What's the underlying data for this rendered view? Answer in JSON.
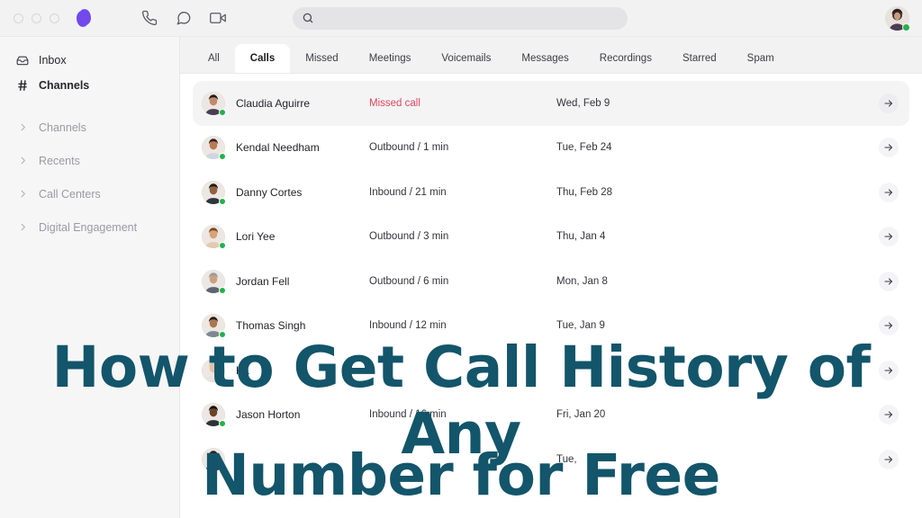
{
  "window": {
    "dots": [
      "close-dot",
      "minimize-dot",
      "maximize-dot"
    ],
    "logo_name": "app-logo",
    "logo_color": "#7149ec"
  },
  "topbar": {
    "icons": [
      {
        "name": "phone-icon",
        "label": "Phone"
      },
      {
        "name": "chat-icon",
        "label": "Messages"
      },
      {
        "name": "video-icon",
        "label": "Video"
      }
    ],
    "search": {
      "value": "",
      "placeholder": "",
      "icon": "search-icon"
    },
    "avatar": {
      "name": "user-avatar",
      "status": "online",
      "status_color": "#22b14c"
    }
  },
  "sidebar": {
    "primary": [
      {
        "label": "Inbox",
        "icon": "inbox-icon",
        "bold": false
      },
      {
        "label": "Channels",
        "icon": "hash-icon",
        "bold": true
      }
    ],
    "groups": [
      {
        "label": "Channels",
        "icon": "chevron-right-icon"
      },
      {
        "label": "Recents",
        "icon": "chevron-right-icon"
      },
      {
        "label": "Call Centers",
        "icon": "chevron-right-icon"
      },
      {
        "label": "Digital Engagement",
        "icon": "chevron-right-icon"
      }
    ]
  },
  "tabs": [
    {
      "label": "All",
      "active": false
    },
    {
      "label": "Calls",
      "active": true
    },
    {
      "label": "Missed",
      "active": false
    },
    {
      "label": "Meetings",
      "active": false
    },
    {
      "label": "Voicemails",
      "active": false
    },
    {
      "label": "Messages",
      "active": false
    },
    {
      "label": "Recordings",
      "active": false
    },
    {
      "label": "Starred",
      "active": false
    },
    {
      "label": "Spam",
      "active": false
    }
  ],
  "calls": [
    {
      "name": "Claudia Aguirre",
      "type": "Missed call",
      "missed": true,
      "date": "Wed, Feb 9",
      "selected": true,
      "avatar_color": "#3a3340",
      "status": "online"
    },
    {
      "name": "Kendal Needham",
      "type": "Outbound / 1 min",
      "missed": false,
      "date": "Tue, Feb 24",
      "selected": false,
      "avatar_color": "#7a4a2e",
      "status": "online"
    },
    {
      "name": "Danny Cortes",
      "type": "Inbound / 21 min",
      "missed": false,
      "date": "Thu, Feb 28",
      "selected": false,
      "avatar_color": "#4a3c33",
      "status": "online"
    },
    {
      "name": "Lori Yee",
      "type": "Outbound / 3 min",
      "missed": false,
      "date": "Thu, Jan 4",
      "selected": false,
      "avatar_color": "#b08968",
      "status": "online"
    },
    {
      "name": "Jordan Fell",
      "type": "Outbound / 6 min",
      "missed": false,
      "date": "Mon, Jan 8",
      "selected": false,
      "avatar_color": "#9a9a9e",
      "status": "online"
    },
    {
      "name": "Thomas Singh",
      "type": "Inbound / 12 min",
      "missed": false,
      "date": "Tue, Jan 9",
      "selected": false,
      "avatar_color": "#6b5344",
      "status": "online"
    },
    {
      "name": "Ka",
      "type": "",
      "missed": false,
      "date": "",
      "selected": false,
      "avatar_color": "#d2c0b0",
      "status": "online"
    },
    {
      "name": "Jason Horton",
      "type": "Inbound / 16 min",
      "missed": false,
      "date": "Fri, Jan 20",
      "selected": false,
      "avatar_color": "#3e2a20",
      "status": "online"
    },
    {
      "name": "",
      "type": "",
      "missed": false,
      "date": "Tue,",
      "selected": false,
      "avatar_color": "#443b3f",
      "status": "online"
    }
  ],
  "overlay": {
    "line1": "How to Get Call History of Any",
    "line2": "Number for Free",
    "color": "#13556a"
  }
}
